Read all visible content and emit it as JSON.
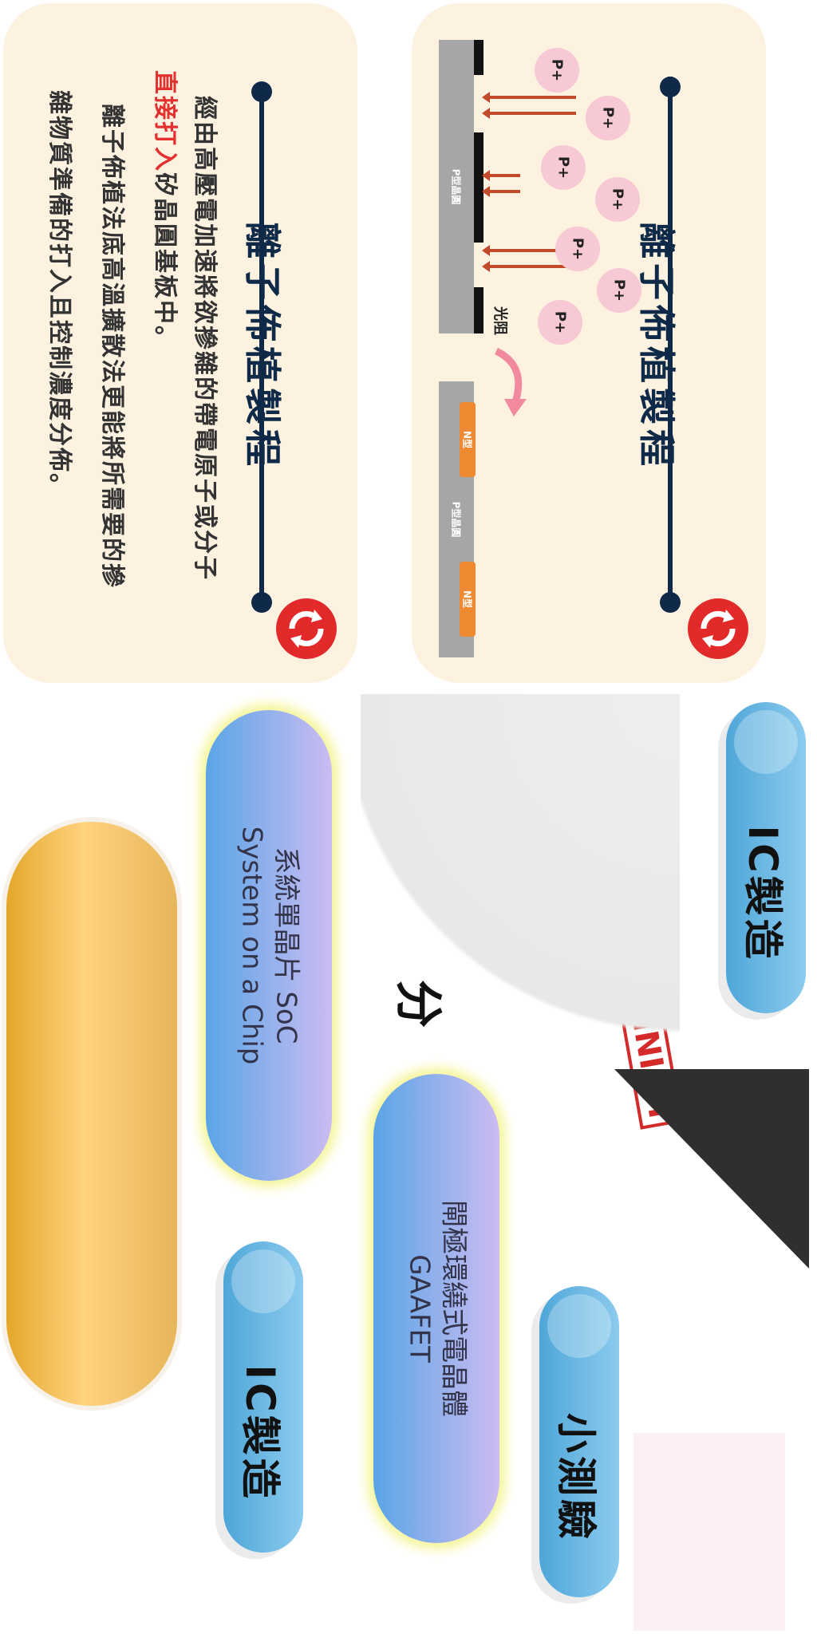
{
  "card_top": {
    "title": "離子佈植製程",
    "diagram": {
      "ion_label": "P+",
      "wafer_label": "P型晶圓",
      "resist_label": "光阻",
      "ntype_label": "N型"
    }
  },
  "card_bottom": {
    "title": "離子佈植製程",
    "paragraph_1_a": "經由高壓電加速將欲摻雜的帶電原子或分子",
    "paragraph_1_highlight": "直接打入",
    "paragraph_1_b": "矽晶圓基板中。",
    "paragraph_2_a": "離子佈植法底高溫擴散法更能將所需要的摻",
    "paragraph_2_b": "雜物質準備的打入且控制濃度分佈。"
  },
  "tabs": {
    "ic_top": "IC製造",
    "ic_bottom": "IC製造",
    "quiz": "小測驗"
  },
  "stamp": "FINISH",
  "score_char": "分",
  "pills": {
    "soc_line1": "系統單晶片 SoC",
    "soc_line2": "System on a Chip",
    "gaafet_line1": "閘極環繞式電晶體",
    "gaafet_line2": "GAAFET"
  },
  "colors": {
    "card_bg": "#fdf1e0",
    "title": "#0e2a48",
    "highlight": "#e53030",
    "badge": "#e32a2a"
  }
}
